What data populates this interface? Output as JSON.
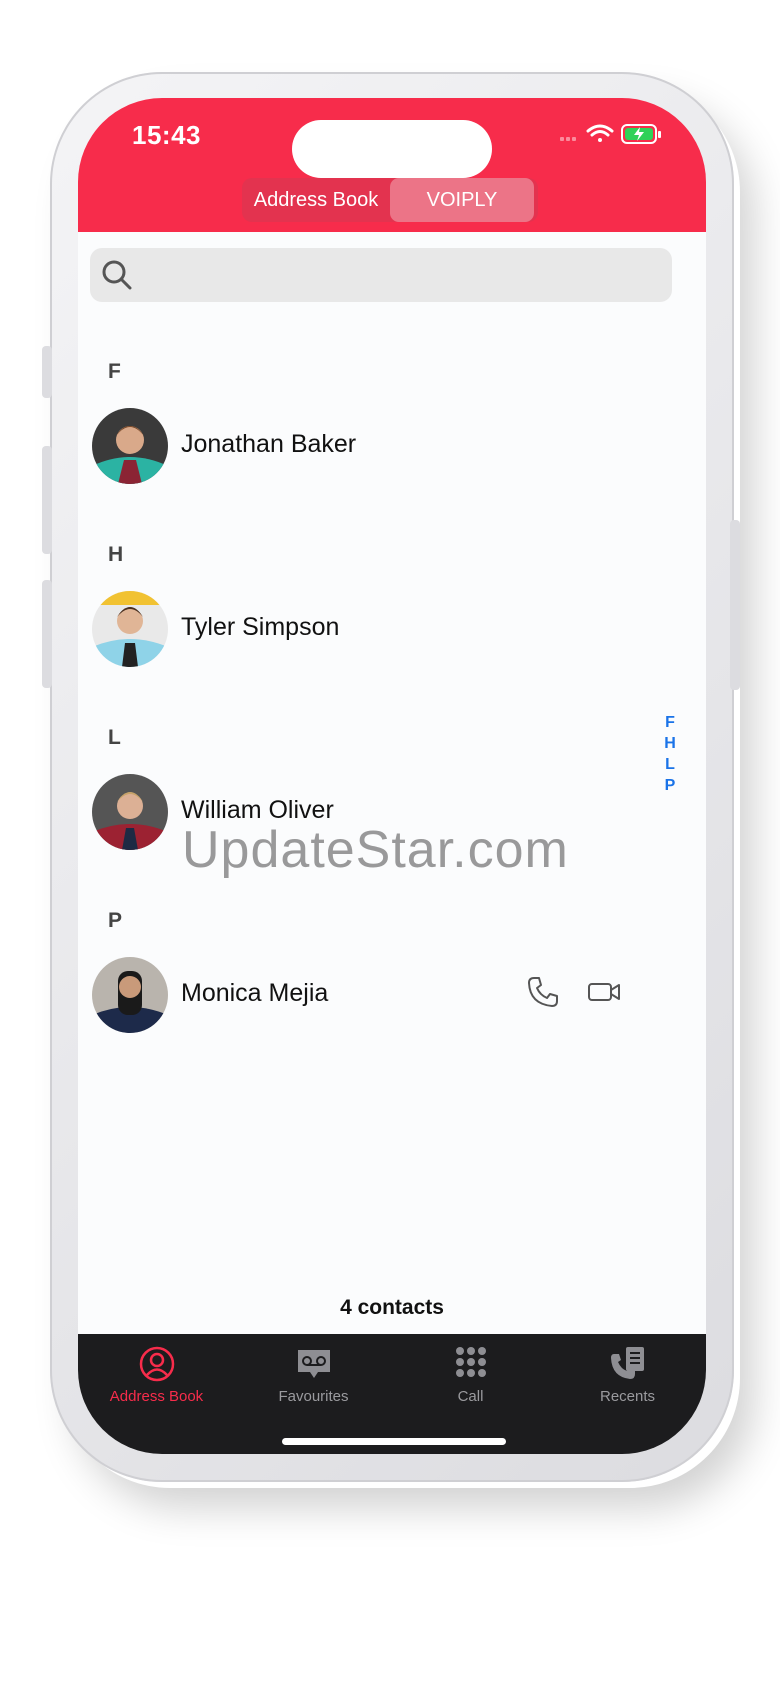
{
  "status": {
    "time": "15:43"
  },
  "segmented": {
    "address_book": "Address Book",
    "voiply": "VOIPLY"
  },
  "search": {
    "placeholder": ""
  },
  "sections": [
    {
      "letter": "F",
      "contact": "Jonathan Baker"
    },
    {
      "letter": "H",
      "contact": "Tyler Simpson"
    },
    {
      "letter": "L",
      "contact": "William Oliver"
    },
    {
      "letter": "P",
      "contact": "Monica Mejia"
    }
  ],
  "index_letters": [
    "F",
    "H",
    "L",
    "P"
  ],
  "watermark": "UpdateStar.com",
  "contacts_count": "4 contacts",
  "tabbar": {
    "address_book": "Address Book",
    "favourites": "Favourites",
    "call": "Call",
    "recents": "Recents"
  },
  "colors": {
    "accent": "#f72c4b",
    "index_blue": "#1a73e8",
    "tabbar_bg": "#1c1c1e"
  },
  "icons": [
    "search-icon",
    "phone-icon",
    "video-icon",
    "person-circle-icon",
    "voicemail-icon",
    "keypad-icon",
    "recents-icon",
    "wifi-icon",
    "battery-icon"
  ]
}
